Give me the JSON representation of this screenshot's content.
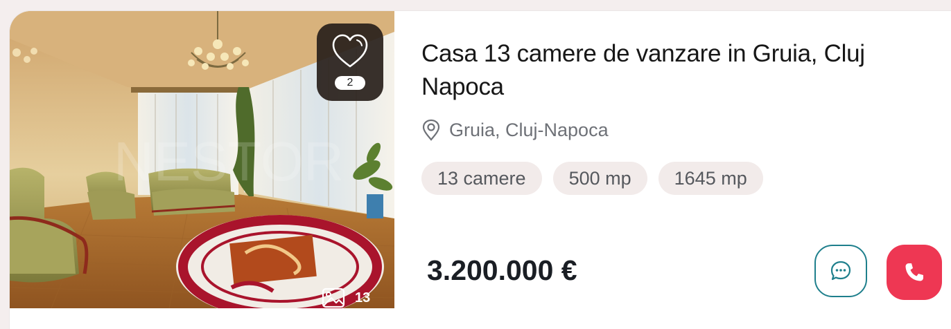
{
  "listing": {
    "title": "Casa 13 camere de vanzare in Gruia, Cluj Napoca",
    "location": "Gruia, Cluj-Napoca",
    "tags": [
      "13 camere",
      "500 mp",
      "1645 mp"
    ],
    "price": "3.200.000 €",
    "favorites_count": "2",
    "photos_count": "13"
  },
  "icons": {
    "favorite": "heart-icon",
    "location": "map-pin-icon",
    "photos": "image-icon",
    "chat": "chat-bubble-icon",
    "call": "phone-icon"
  },
  "colors": {
    "accent_teal": "#1e7f8c",
    "call_red": "#ee3753",
    "tag_bg": "#f2ebea"
  }
}
